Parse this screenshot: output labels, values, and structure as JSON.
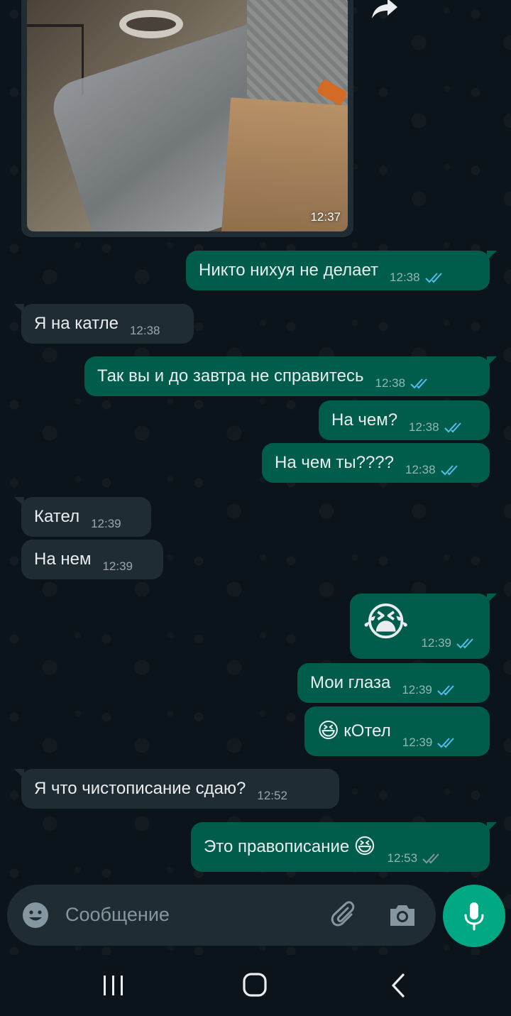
{
  "image_message": {
    "time": "12:37"
  },
  "messages": [
    {
      "dir": "out",
      "text": "Никто нихуя не делает",
      "time": "12:38",
      "status": "read"
    },
    {
      "dir": "in",
      "text": "Я на катле",
      "time": "12:38"
    },
    {
      "dir": "out",
      "text": "Так вы и до завтра не справитесь",
      "time": "12:38",
      "status": "read"
    },
    {
      "dir": "out",
      "text": "На чем?",
      "time": "12:38",
      "status": "read"
    },
    {
      "dir": "out",
      "text": "На чем ты????",
      "time": "12:38",
      "status": "read"
    },
    {
      "dir": "in",
      "text": "Кател",
      "time": "12:39"
    },
    {
      "dir": "in",
      "text": "На нем",
      "time": "12:39"
    },
    {
      "dir": "out",
      "emoji": "😭",
      "time": "12:39",
      "status": "read"
    },
    {
      "dir": "out",
      "text": "Мои глаза",
      "time": "12:39",
      "status": "read"
    },
    {
      "dir": "out",
      "emoji": "😆",
      "text": "кОтел",
      "time": "12:39",
      "status": "read"
    },
    {
      "dir": "in",
      "text": "Я что чистописание сдаю?",
      "time": "12:52"
    },
    {
      "dir": "out",
      "text": "Это правописание",
      "emoji": "😆",
      "time": "12:53",
      "status": "delivered"
    }
  ],
  "composer": {
    "placeholder": "Сообщение"
  },
  "icons": {
    "emoji": "smiley-icon",
    "attach": "paperclip-icon",
    "camera": "camera-icon",
    "mic": "microphone-icon",
    "forward": "forward-icon"
  },
  "colors": {
    "background": "#0b141a",
    "bubble_out": "#005c4b",
    "bubble_in": "#202c33",
    "ticks_read": "#53bdeb",
    "accent": "#00a884"
  }
}
